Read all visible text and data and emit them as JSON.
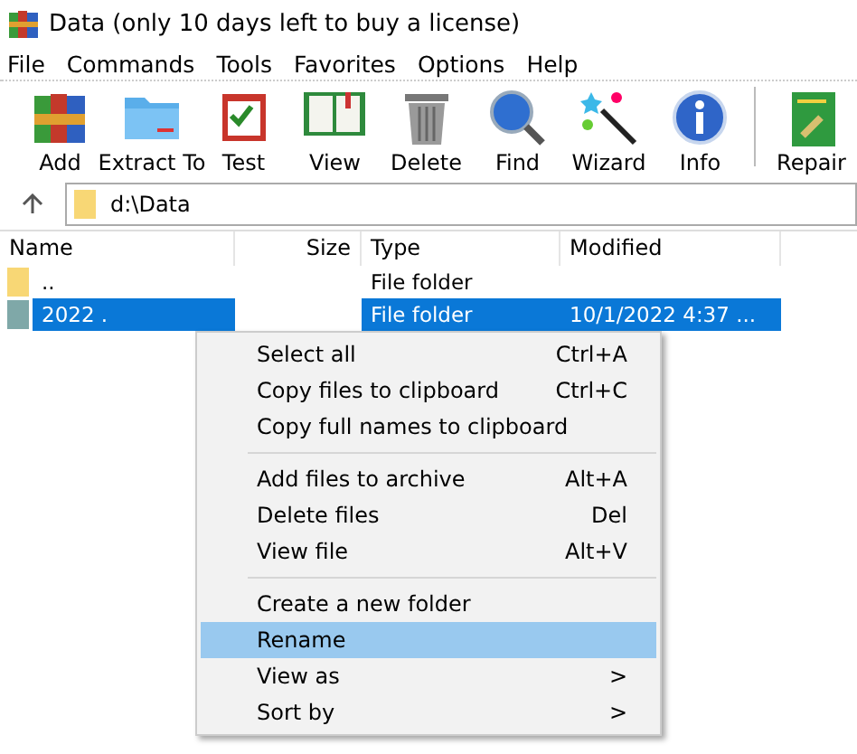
{
  "window": {
    "title": "Data (only 10 days left to buy a license)"
  },
  "menu_bar": [
    "File",
    "Commands",
    "Tools",
    "Favorites",
    "Options",
    "Help"
  ],
  "toolbar": [
    {
      "label": "Add",
      "kind": "add"
    },
    {
      "label": "Extract To",
      "kind": "extract"
    },
    {
      "label": "Test",
      "kind": "test"
    },
    {
      "label": "View",
      "kind": "view"
    },
    {
      "label": "Delete",
      "kind": "delete"
    },
    {
      "label": "Find",
      "kind": "find"
    },
    {
      "label": "Wizard",
      "kind": "wizard"
    },
    {
      "label": "Info",
      "kind": "info"
    },
    {
      "label": "Repair",
      "kind": "repair"
    }
  ],
  "address": {
    "value": "d:\\Data"
  },
  "table": {
    "columns": [
      "Name",
      "Size",
      "Type",
      "Modified"
    ],
    "rows": [
      {
        "name": "..",
        "size": "",
        "type": "File folder",
        "modified": "",
        "selected": false
      },
      {
        "name": "2022 .",
        "size": "",
        "type": "File folder",
        "modified": "10/1/2022 4:37 ...",
        "selected": true
      }
    ]
  },
  "context_menu": [
    {
      "kind": "item",
      "label": "Select all",
      "shortcut": "Ctrl+A",
      "selected": false
    },
    {
      "kind": "item",
      "label": "Copy files to clipboard",
      "shortcut": "Ctrl+C",
      "selected": false
    },
    {
      "kind": "item",
      "label": "Copy full names to clipboard",
      "selected": false
    },
    {
      "kind": "separator"
    },
    {
      "kind": "item",
      "label": "Add files to archive",
      "shortcut": "Alt+A",
      "selected": false
    },
    {
      "kind": "item",
      "label": "Delete files",
      "shortcut": "Del",
      "selected": false
    },
    {
      "kind": "item",
      "label": "View file",
      "shortcut": "Alt+V",
      "selected": false
    },
    {
      "kind": "separator"
    },
    {
      "kind": "item",
      "label": "Create a new folder",
      "selected": false
    },
    {
      "kind": "item",
      "label": "Rename",
      "selected": true
    },
    {
      "kind": "item",
      "label": "View as",
      "submenu": ">",
      "selected": false
    },
    {
      "kind": "item",
      "label": "Sort by",
      "submenu": ">",
      "selected": false
    }
  ]
}
